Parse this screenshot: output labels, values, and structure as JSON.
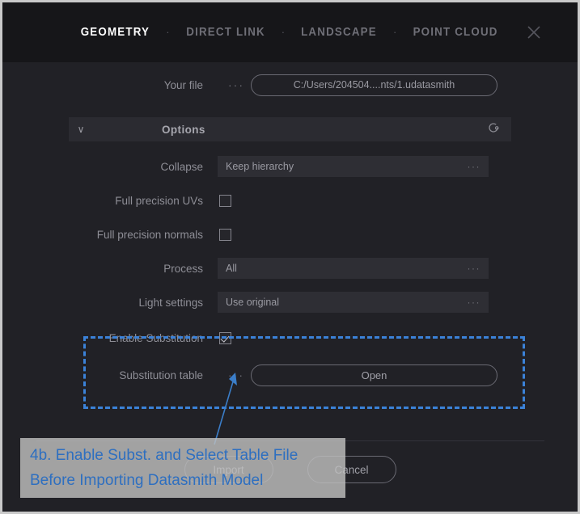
{
  "header": {
    "tabs": [
      {
        "label": "GEOMETRY",
        "active": true
      },
      {
        "label": "DIRECT LINK",
        "active": false
      },
      {
        "label": "LANDSCAPE",
        "active": false
      },
      {
        "label": "POINT CLOUD",
        "active": false
      }
    ],
    "separator": "·",
    "close_icon": "close-icon"
  },
  "file": {
    "label": "Your file",
    "browse_dots": "···",
    "path": "C:/Users/204504....nts/1.udatasmith"
  },
  "options": {
    "chevron": "∨",
    "title": "Options",
    "reset_icon": "reset-icon"
  },
  "rows": {
    "collapse": {
      "label": "Collapse",
      "value": "Keep hierarchy",
      "dots": "···"
    },
    "full_precision_uvs": {
      "label": "Full precision UVs",
      "checked": false
    },
    "full_precision_normals": {
      "label": "Full precision normals",
      "checked": false
    },
    "process": {
      "label": "Process",
      "value": "All",
      "dots": "···"
    },
    "light_settings": {
      "label": "Light settings",
      "value": "Use original",
      "dots": "···"
    },
    "enable_substitution": {
      "label": "Enable Substitution",
      "checked": true
    },
    "substitution_table": {
      "label": "Substitution table",
      "dots": "···",
      "button": "Open"
    }
  },
  "footer": {
    "import_label": "Import",
    "cancel_label": "Cancel"
  },
  "annotation": {
    "line1": "4b. Enable Subst. and Select Table File",
    "line2": "Before Importing Datasmith Model",
    "color": "#2e6fc0",
    "highlight_color": "#3b82d8"
  }
}
